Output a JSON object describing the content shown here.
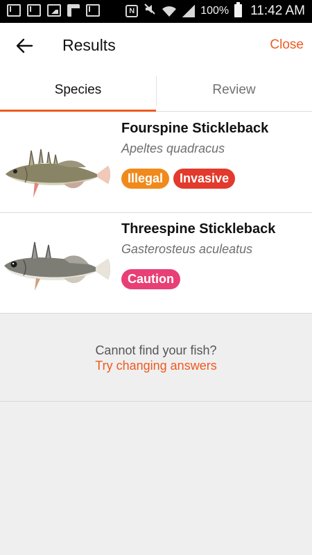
{
  "statusbar": {
    "battery_pct": "100%",
    "time": "11:42 AM",
    "icons": [
      "mail-icon",
      "mail-icon",
      "image-icon",
      "flipboard-icon",
      "mail-icon",
      "nfc-icon",
      "mute-icon",
      "wifi-icon",
      "signal-icon",
      "battery-icon"
    ]
  },
  "appbar": {
    "back_icon": "arrow-left-icon",
    "title": "Results",
    "close_label": "Close"
  },
  "tabs": [
    {
      "label": "Species",
      "active": true
    },
    {
      "label": "Review",
      "active": false
    }
  ],
  "results": [
    {
      "name": "Fourspine Stickleback",
      "scientific": "Apeltes quadracus",
      "tags": [
        {
          "label": "Illegal",
          "color": "#f08a1c"
        },
        {
          "label": "Invasive",
          "color": "#e23a2c"
        }
      ]
    },
    {
      "name": "Threespine Stickleback",
      "scientific": "Gasterosteus aculeatus",
      "tags": [
        {
          "label": "Caution",
          "color": "#e83f76"
        }
      ]
    }
  ],
  "footer": {
    "question": "Cannot find your fish?",
    "link": "Try changing answers"
  },
  "colors": {
    "accent": "#ee5a20",
    "background": "#efefef"
  }
}
